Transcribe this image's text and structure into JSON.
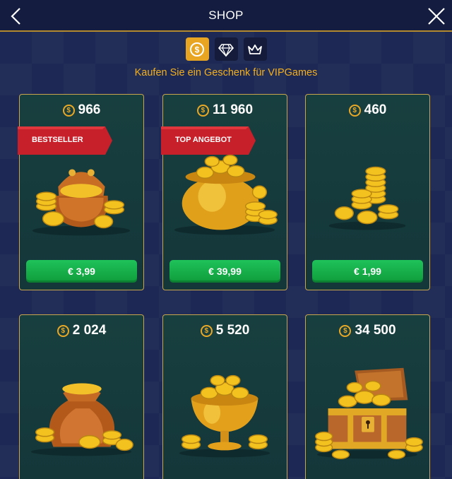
{
  "header": {
    "title": "SHOP"
  },
  "tabs": [
    {
      "name": "coins",
      "icon": "coin-tab-icon",
      "active": true
    },
    {
      "name": "diamonds",
      "icon": "diamond-icon",
      "active": false
    },
    {
      "name": "vip",
      "icon": "crown-icon",
      "active": false
    }
  ],
  "subtitle": "Kaufen Sie ein Geschenk für VIPGames",
  "coin_symbol": "$",
  "products": [
    {
      "amount": "966",
      "badge": "BESTSELLER",
      "price": "€ 3,99",
      "illustration": "coin-purse"
    },
    {
      "amount": "11 960",
      "badge": "TOP ANGEBOT",
      "price": "€ 39,99",
      "illustration": "pot-of-gold"
    },
    {
      "amount": "460",
      "badge": "",
      "price": "€ 1,99",
      "illustration": "coin-stacks"
    },
    {
      "amount": "2 024",
      "badge": "",
      "price": "",
      "illustration": "coin-sack"
    },
    {
      "amount": "5 520",
      "badge": "",
      "price": "",
      "illustration": "coin-chalice"
    },
    {
      "amount": "34 500",
      "badge": "",
      "price": "",
      "illustration": "treasure-chest"
    }
  ],
  "colors": {
    "accent": "#e8a521",
    "price_button": "#15b04b",
    "card_border": "#c9a54e",
    "ribbon": "#c8202a"
  }
}
